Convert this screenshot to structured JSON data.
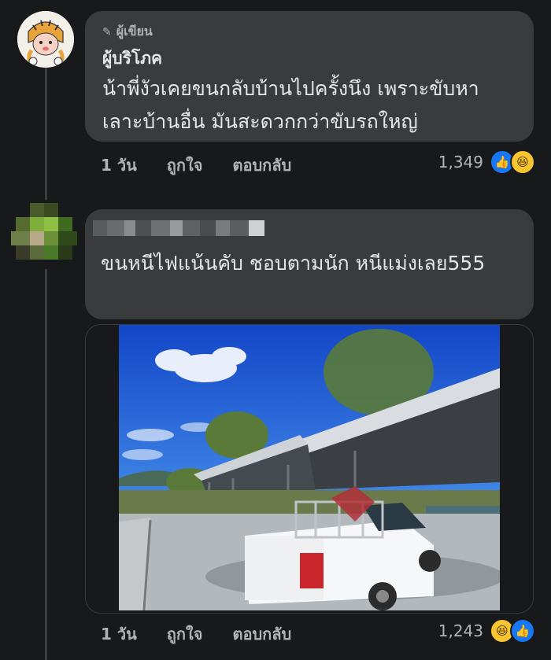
{
  "comment1": {
    "badge": "ผู้เขียน",
    "author": "ผู้บริโภค",
    "text": "น้าพี่งัวเคยขนกลับบ้านไปครั้งนึง เพราะขับหาเลาะบ้านอื่น มันสะดวกกว่าขับรถใหญ่",
    "time": "1 วัน",
    "like_label": "ถูกใจ",
    "reply_label": "ตอบกลับ",
    "reaction_count": "1,349",
    "reaction_icons": [
      "like-icon",
      "haha-icon"
    ]
  },
  "comment2": {
    "author": "",
    "text": "ขนหนีไฟแน้นคับ ชอบตามนัก หนีแม่งเลย555",
    "time": "1 วัน",
    "like_label": "ถูกใจ",
    "reply_label": "ตอบกลับ",
    "reaction_count": "1,243",
    "reaction_icons": [
      "haha-icon",
      "like-icon"
    ]
  },
  "colors": {
    "background": "#18191a",
    "bubble": "#3a3b3c",
    "like": "#1877f2",
    "haha": "#f7c531"
  }
}
